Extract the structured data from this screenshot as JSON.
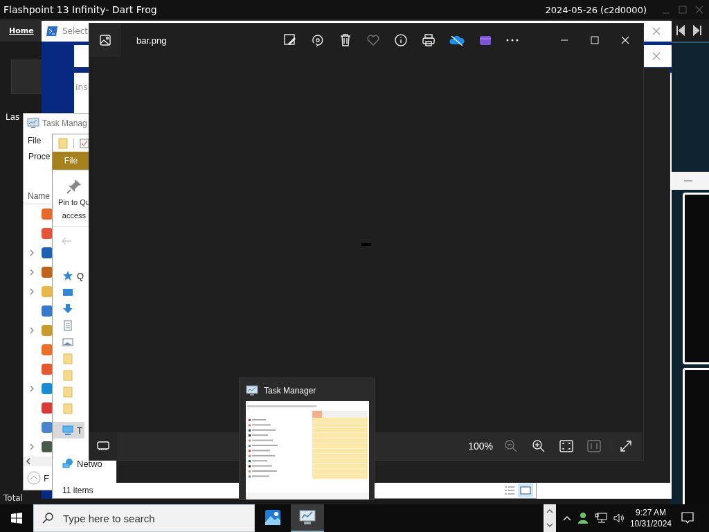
{
  "flashpoint": {
    "title": "Flashpoint 13 Infinity- Dart Frog",
    "version": "2024-05-26 (c2d0000)",
    "nav_link": "Home",
    "label": "Las",
    "footer": "Total"
  },
  "installer": {
    "title": "Select",
    "text": "Ins"
  },
  "task_manager": {
    "title": "Task Manag",
    "menu": "File",
    "tab": "Proce",
    "column": "Name",
    "rows": [
      {
        "expandable": false,
        "color": "#e66a2c"
      },
      {
        "expandable": false,
        "color": "#e2553a"
      },
      {
        "expandable": true,
        "color": "#1f5fb0"
      },
      {
        "expandable": true,
        "color": "#c0641c"
      },
      {
        "expandable": true,
        "color": "#e8b84a"
      },
      {
        "expandable": false,
        "color": "#3a78c8"
      },
      {
        "expandable": true,
        "color": "#c99a2e"
      },
      {
        "expandable": false,
        "color": "#e8702a"
      },
      {
        "expandable": false,
        "color": "#e45a30"
      },
      {
        "expandable": true,
        "color": "#1b8bd0"
      },
      {
        "expandable": false,
        "color": "#d83a3a"
      },
      {
        "expandable": false,
        "color": "#4a84cc"
      },
      {
        "expandable": true,
        "color": "#4a5a4a"
      }
    ],
    "footer_button": "F"
  },
  "explorer": {
    "ribbon_tab": "File",
    "pin_label": "Pin to Qu",
    "pin_label_2": "access",
    "tree": [
      {
        "kind": "star",
        "label": "Q",
        "selected": false
      },
      {
        "kind": "desktop",
        "selected": false
      },
      {
        "kind": "download",
        "selected": false
      },
      {
        "kind": "document",
        "selected": false
      },
      {
        "kind": "pictures",
        "selected": false
      },
      {
        "kind": "folder",
        "selected": false
      },
      {
        "kind": "folder",
        "selected": false
      },
      {
        "kind": "folder",
        "selected": false
      },
      {
        "kind": "folder",
        "selected": false
      },
      {
        "kind": "pc",
        "label": "T",
        "selected": true
      },
      {
        "kind": "network",
        "label": "Netwo",
        "selected": false
      }
    ],
    "status": "11 items"
  },
  "photos": {
    "file_name": "bar.png",
    "zoom": "100%"
  },
  "thumbnail": {
    "title": "Task Manager"
  },
  "taskbar": {
    "search": {
      "placeholder": "Type here to search"
    },
    "apps": [
      {
        "kind": "photos",
        "selected": false
      },
      {
        "kind": "task-manager",
        "selected": true
      }
    ],
    "time": "9:27 AM",
    "date": "10/31/2024"
  }
}
